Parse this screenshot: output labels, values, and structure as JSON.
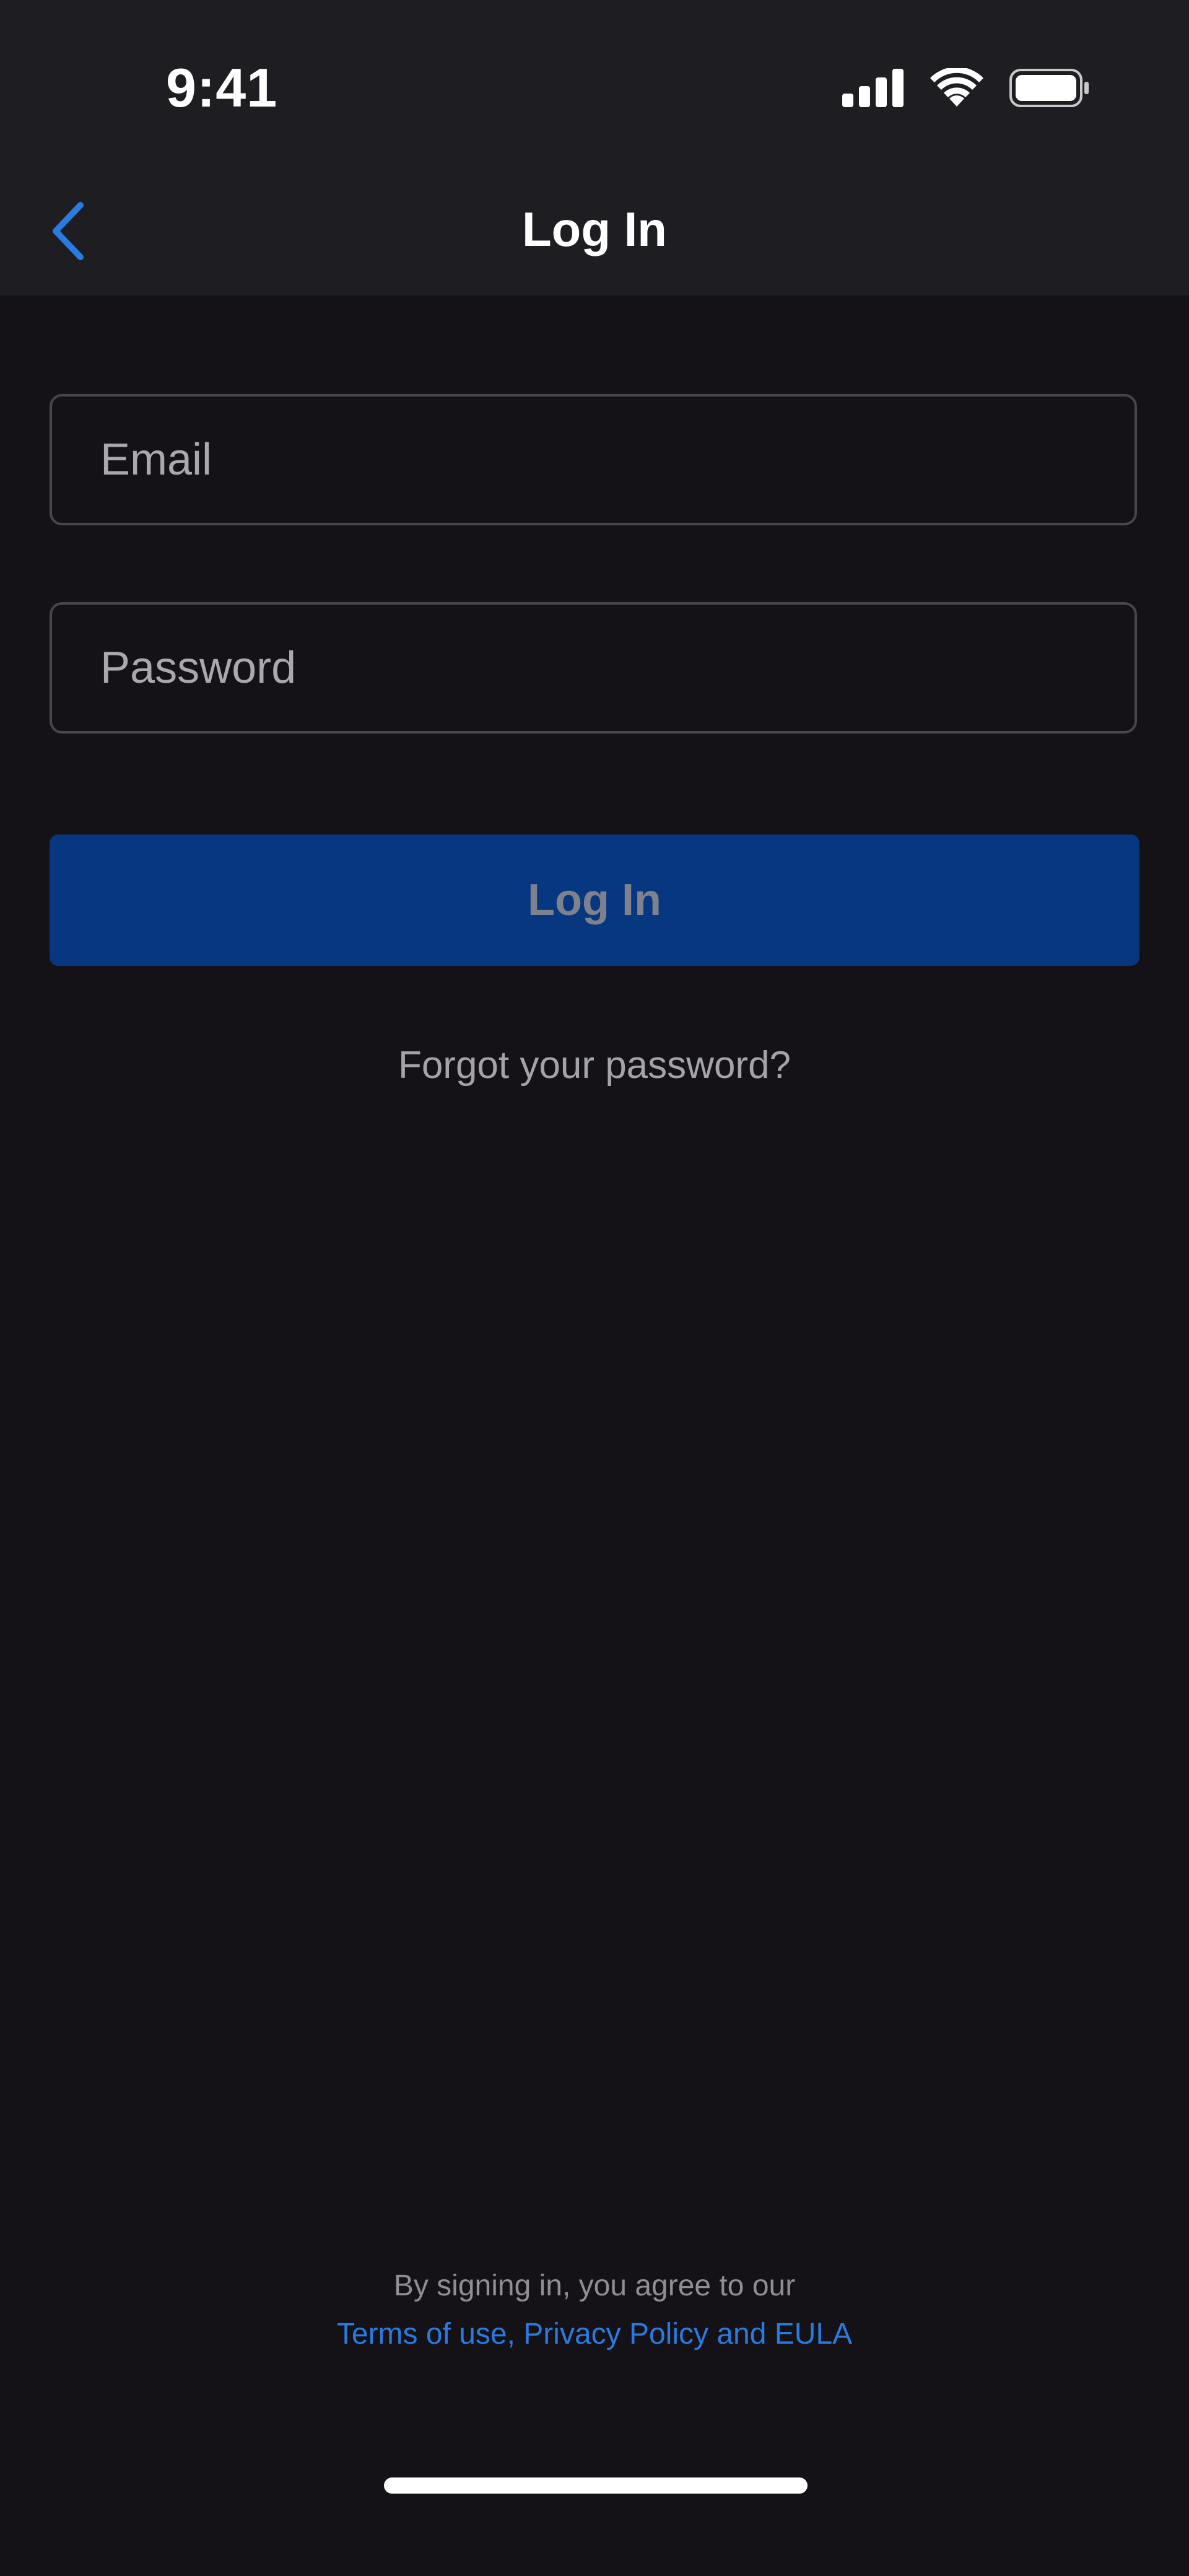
{
  "status_bar": {
    "time": "9:41",
    "icons": [
      "cellular-signal-icon",
      "wifi-icon",
      "battery-icon"
    ]
  },
  "nav": {
    "title": "Log In",
    "back_icon": "chevron-left-icon"
  },
  "form": {
    "email": {
      "placeholder": "Email",
      "value": ""
    },
    "password": {
      "placeholder": "Password",
      "value": ""
    },
    "submit_label": "Log In",
    "forgot_label": "Forgot your password?"
  },
  "legal": {
    "line1": "By signing in, you agree to our",
    "links": "Terms of use, Privacy Policy and EULA"
  },
  "colors": {
    "accent": "#2a7bdf",
    "button_bg": "#073780",
    "background": "#141216",
    "header_bg": "#1e1d22"
  }
}
